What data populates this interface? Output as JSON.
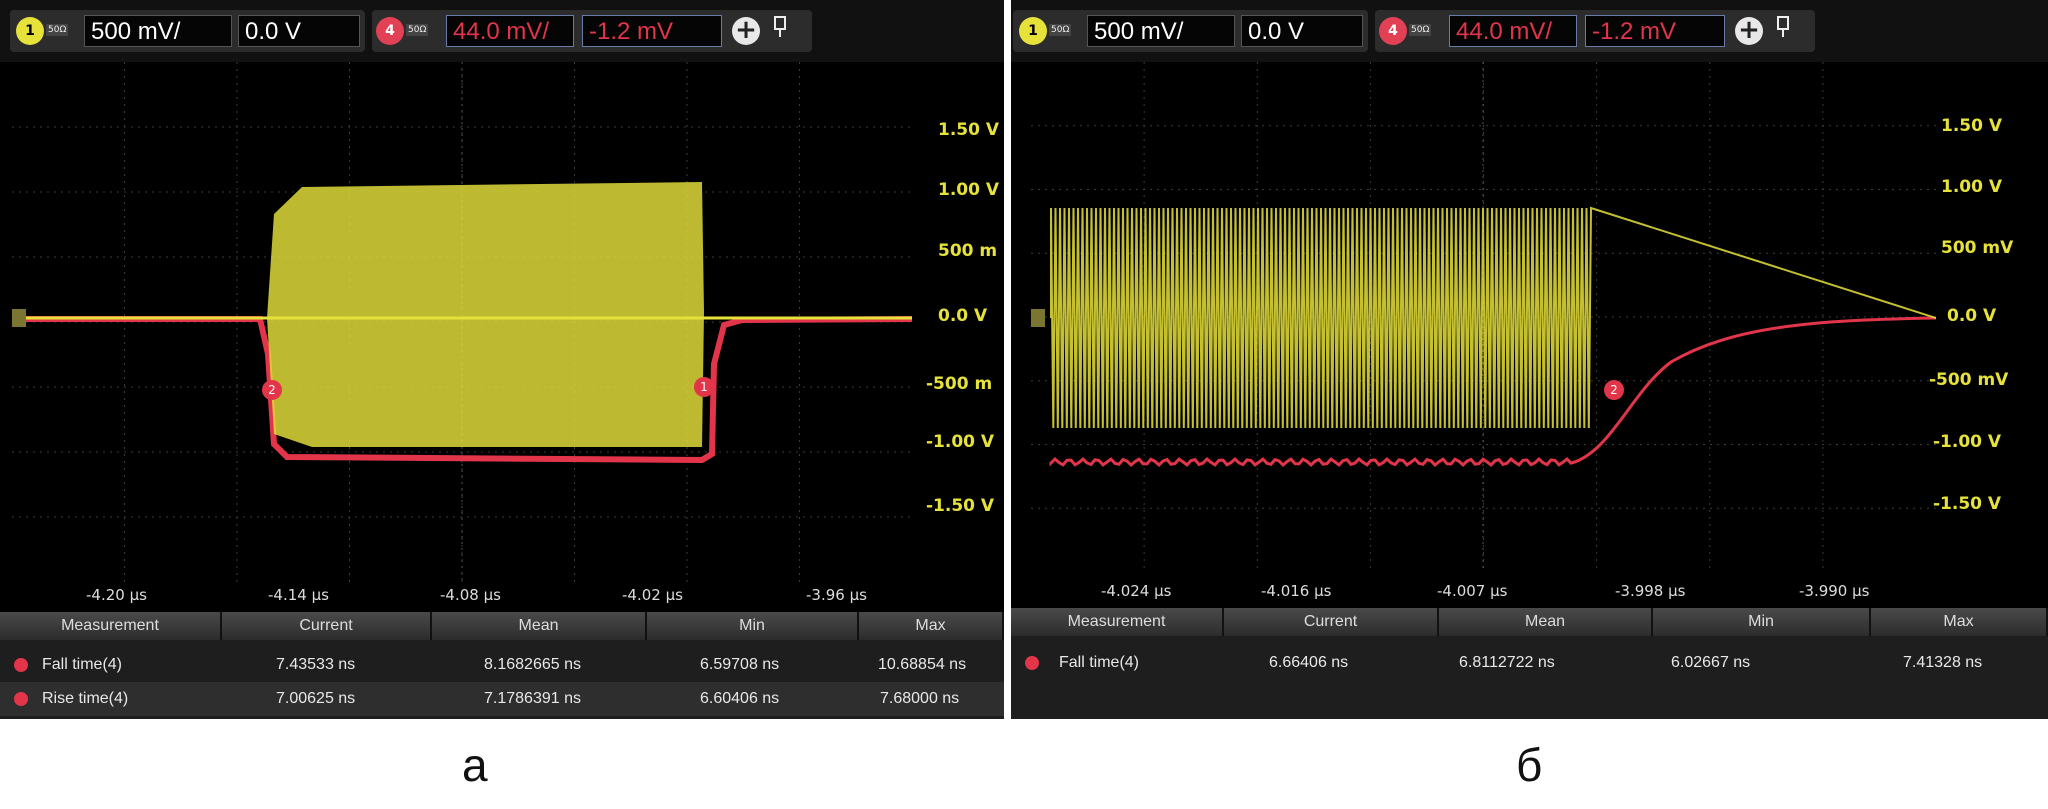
{
  "panels": [
    {
      "id": "a",
      "caption": "а",
      "toolbar": {
        "ch1_number": "1",
        "ch1_impedance": "50Ω",
        "ch1_scale": "500 mV/",
        "ch1_offset": "0.0 V",
        "ch4_number": "4",
        "ch4_impedance": "50Ω",
        "ch4_scale": "44.0 mV/",
        "ch4_offset": "-1.2 mV",
        "add_label": "+",
        "pin_icon": "pin-icon"
      },
      "y_ticks": [
        "1.50 V",
        "1.00 V",
        "500 m",
        "0.0 V",
        "-500 m",
        "-1.00 V",
        "-1.50 V"
      ],
      "x_ticks": [
        "-4.20 μs",
        "-4.14 μs",
        "-4.08 μs",
        "-4.02 μs",
        "-3.96 μs"
      ],
      "cursor_labels": [
        "2",
        "1"
      ],
      "measurements": {
        "headers": [
          "Measurement",
          "Current",
          "Mean",
          "Min",
          "Max"
        ],
        "rows": [
          {
            "name": "Fall time(4)",
            "current": "7.43533 ns",
            "mean": "8.1682665 ns",
            "min": "6.59708 ns",
            "max": "10.68854 ns"
          },
          {
            "name": "Rise time(4)",
            "current": "7.00625 ns",
            "mean": "7.1786391 ns",
            "min": "6.60406 ns",
            "max": "7.68000 ns"
          }
        ]
      }
    },
    {
      "id": "b",
      "caption": "б",
      "toolbar": {
        "ch1_number": "1",
        "ch1_impedance": "50Ω",
        "ch1_scale": "500 mV/",
        "ch1_offset": "0.0 V",
        "ch4_number": "4",
        "ch4_impedance": "50Ω",
        "ch4_scale": "44.0 mV/",
        "ch4_offset": "-1.2 mV",
        "add_label": "+",
        "pin_icon": "pin-icon"
      },
      "y_ticks": [
        "1.50 V",
        "1.00 V",
        "500 mV",
        "0.0 V",
        "-500 mV",
        "-1.00 V",
        "-1.50 V"
      ],
      "x_ticks": [
        "-4.024 μs",
        "-4.016 μs",
        "-4.007 μs",
        "-3.998 μs",
        "-3.990 μs"
      ],
      "cursor_labels": [
        "2"
      ],
      "measurements": {
        "headers": [
          "Measurement",
          "Current",
          "Mean",
          "Min",
          "Max"
        ],
        "rows": [
          {
            "name": "Fall time(4)",
            "current": "6.66406 ns",
            "mean": "6.8112722 ns",
            "min": "6.02667 ns",
            "max": "7.41328 ns"
          }
        ]
      }
    }
  ],
  "colors": {
    "ch1": "#e6e23a",
    "ch4": "#e2354a",
    "screen_bg": "#000000",
    "grid": "#3a3a3a"
  }
}
